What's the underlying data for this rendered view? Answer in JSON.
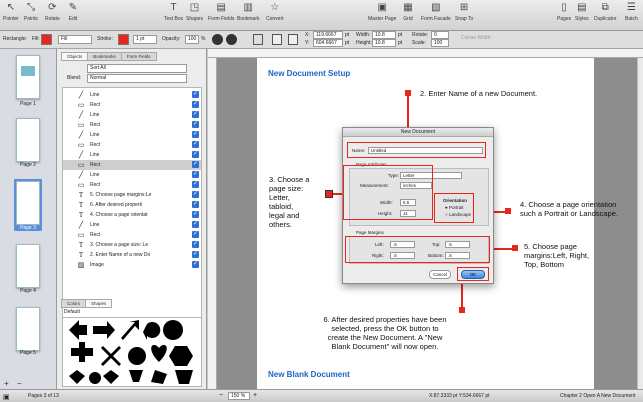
{
  "toolbar": {
    "left_tools": [
      "Pointer",
      "Points",
      "Rotate",
      "Edit"
    ],
    "center_tools": [
      "Text Box",
      "Shapes",
      "Form Fields",
      "Bookmark",
      "Convert"
    ],
    "right_tools": [
      "Master Page",
      "Grid",
      "Form Facade",
      "Snap To"
    ],
    "far_right_tools": [
      "Pages",
      "Styles",
      "Duplicator",
      "Batch"
    ]
  },
  "props": {
    "object_label": "Rectangle:",
    "fill_label": "Fill:",
    "fill_mode": "Fill",
    "stroke_label": "Stroke:",
    "stroke_width": "1 pt",
    "opacity_label": "Opacity:",
    "opacity_value": "100",
    "opacity_unit": "%",
    "x_label": "X:",
    "x_value": "119.6667",
    "y_label": "Y:",
    "y_value": "604.6667",
    "unit": "pt",
    "width_label": "Width:",
    "width_value": "10.8",
    "height_label": "Height:",
    "height_value": "10.8",
    "rotate_label": "Rotate:",
    "rotate_value": "0",
    "scale_label": "Scale:",
    "scale_value": "100",
    "corner_label": "Corner Width:",
    "colors": {
      "fill": "#e8271c",
      "stroke": "#e8271c"
    }
  },
  "thumbnails": {
    "pages": [
      "Page 1",
      "Page 2",
      "Page 3",
      "Page 4",
      "Page 5"
    ],
    "selected": "Page 3"
  },
  "objects_panel": {
    "tabs": [
      "Objects",
      "Bookmarks",
      "Form Fields"
    ],
    "sort_value": "Sort All",
    "blend_label": "Blend:",
    "blend_value": "Normal",
    "items": [
      {
        "icon": "line-icon",
        "label": "Line"
      },
      {
        "icon": "rect-icon",
        "label": "Rect"
      },
      {
        "icon": "line-icon",
        "label": "Line"
      },
      {
        "icon": "rect-icon",
        "label": "Rect"
      },
      {
        "icon": "line-icon",
        "label": "Line"
      },
      {
        "icon": "rect-icon",
        "label": "Rect"
      },
      {
        "icon": "line-icon",
        "label": "Line"
      },
      {
        "icon": "rect-icon",
        "label": "Rect",
        "selected": true
      },
      {
        "icon": "line-icon",
        "label": "Line"
      },
      {
        "icon": "rect-icon",
        "label": "Rect"
      },
      {
        "icon": "text-icon",
        "label": "5. Choose page margins:Le"
      },
      {
        "icon": "text-icon",
        "label": "6. After desired properti"
      },
      {
        "icon": "text-icon",
        "label": "4. Choose a page orientat"
      },
      {
        "icon": "line-icon",
        "label": "Line"
      },
      {
        "icon": "rect-icon",
        "label": "Rect"
      },
      {
        "icon": "text-icon",
        "label": "3. Choose a page size: Le"
      },
      {
        "icon": "text-icon",
        "label": "2. Enter Name of a new Do"
      },
      {
        "icon": "image-icon",
        "label": "Image"
      }
    ],
    "bottom_tabs": [
      "Colors",
      "Shapes"
    ],
    "shapes_label": "Default"
  },
  "document": {
    "heading1": "New Document Setup",
    "heading2": "New Blank Document",
    "step2": "2. Enter Name of a new Document.",
    "step3_lines": [
      "3. Choose a",
      "page size:",
      "Letter,",
      "tabloid,",
      "legal and",
      "others."
    ],
    "step4_lines": [
      "4. Choose a page orientation",
      "such a Portrait or Landscape."
    ],
    "step5_lines": [
      "5. Choose page",
      "margins:Left, Right,",
      "Top, Bottom"
    ],
    "step6_lines": [
      "6. After desired properties have been",
      "selected, press the OK button to",
      "create the New Document. A \"New",
      "Blank Document\" will now open."
    ]
  },
  "dialog": {
    "title": "New Document",
    "name_label": "Name:",
    "name_value": "Untitled",
    "attributes_title": "Page Attributes",
    "type_label": "Type:",
    "type_value": "Letter",
    "measurement_label": "Measurement:",
    "measurement_value": "inches",
    "width_label": "Width:",
    "width_value": "8.5",
    "height_label": "Height:",
    "height_value": "11",
    "orientation_title": "Orientation",
    "portrait": "Portrait",
    "landscape": "Landscape",
    "margins_title": "Page Margins",
    "left_label": "Left:",
    "left_value": ".5",
    "top_label": "Top:",
    "top_value": ".5",
    "right_label": "Right:",
    "right_value": ".5",
    "bottom_label": "Bottom:",
    "bottom_value": ".5",
    "cancel": "Cancel",
    "ok": "OK"
  },
  "status": {
    "pages": "Pages 3 of 13",
    "zoom": "150 %",
    "coords": "X:87.3333 pt  Y:534.6667 pt",
    "chapter": "Chapter 2 Open A New Document"
  }
}
